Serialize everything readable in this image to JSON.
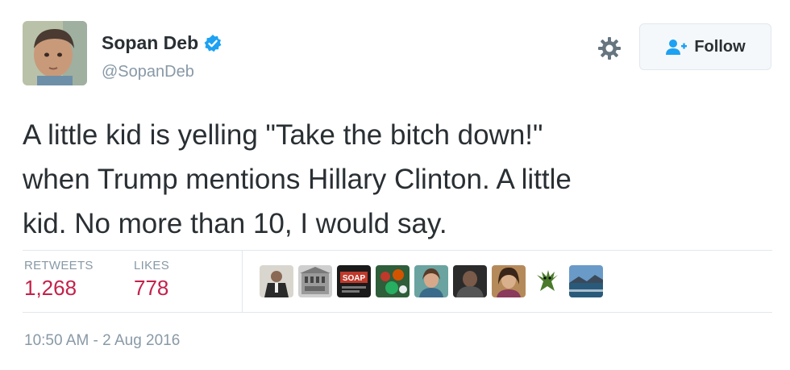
{
  "user": {
    "display_name": "Sopan Deb",
    "handle": "@SopanDeb",
    "verified": true
  },
  "actions": {
    "follow_label": "Follow",
    "settings_icon": "gear-icon",
    "follow_icon": "user-add-icon"
  },
  "tweet": {
    "lines": [
      "A little kid is yelling \"Take the bitch down!\"",
      "when Trump mentions Hillary Clinton. A little",
      "kid. No more than 10, I would say."
    ]
  },
  "stats": {
    "retweets_label": "RETWEETS",
    "retweets_value": "1,268",
    "likes_label": "LIKES",
    "likes_value": "778"
  },
  "liker_avatars": [
    {
      "name": "liker-avatar-1"
    },
    {
      "name": "liker-avatar-2"
    },
    {
      "name": "liker-avatar-3",
      "text": "SOAP"
    },
    {
      "name": "liker-avatar-4"
    },
    {
      "name": "liker-avatar-5"
    },
    {
      "name": "liker-avatar-6"
    },
    {
      "name": "liker-avatar-7"
    },
    {
      "name": "liker-avatar-8"
    },
    {
      "name": "liker-avatar-9"
    }
  ],
  "timestamp": "10:50 AM - 2 Aug 2016",
  "colors": {
    "accent_red": "#c3224a",
    "verified_blue": "#1da1f2",
    "muted": "#8899a6"
  }
}
